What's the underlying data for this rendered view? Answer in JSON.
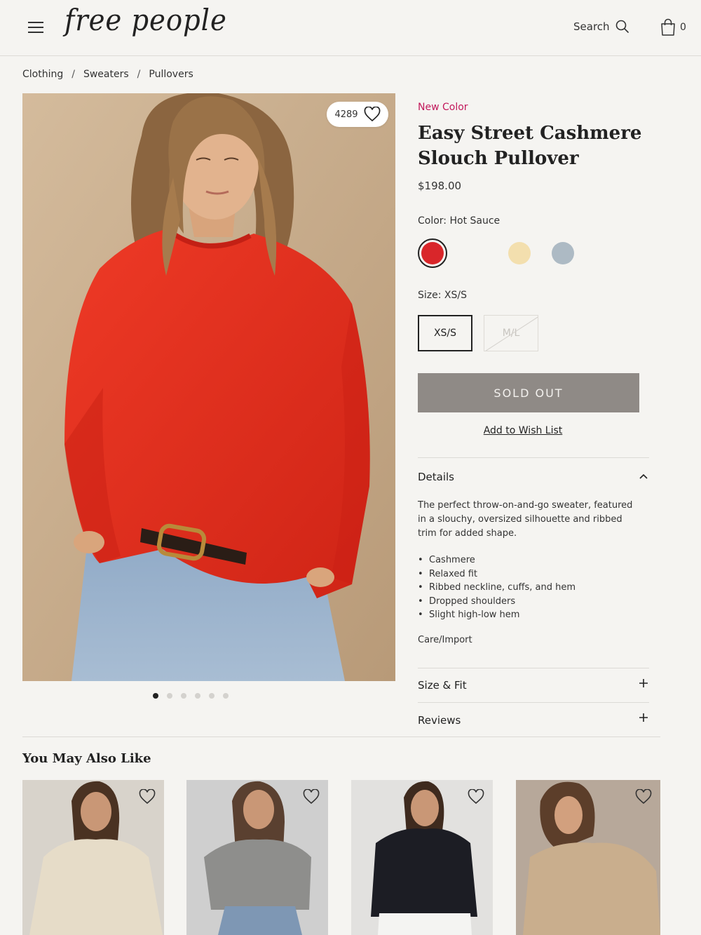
{
  "header": {
    "logo": "free people",
    "search_label": "Search",
    "bag_count": "0"
  },
  "breadcrumb": [
    "Clothing",
    "Sweaters",
    "Pullovers"
  ],
  "gallery": {
    "like_count": "4289",
    "dots_total": 6,
    "active_dot": 1
  },
  "product": {
    "badge": "New Color",
    "title": "Easy Street Cashmere Slouch Pullover",
    "price": "$198.00",
    "color_label": "Color: Hot Sauce",
    "colors": [
      "#d9262a",
      "#8a7f76",
      "#f3dfae",
      "#adbac4"
    ],
    "selected_color": "Hot Sauce",
    "size_label": "Size: XS/S",
    "sizes": [
      {
        "label": "XS/S",
        "state": "selected"
      },
      {
        "label": "M/L",
        "state": "unavailable"
      }
    ],
    "cta": "SOLD OUT",
    "wishlist": "Add to Wish List"
  },
  "details": {
    "title": "Details",
    "description": "The perfect throw-on-and-go sweater, featured in a slouchy, oversized silhouette and ribbed trim for added shape.",
    "bullets": [
      "Cashmere",
      "Relaxed fit",
      "Ribbed neckline, cuffs, and hem",
      "Dropped shoulders",
      "Slight high-low hem"
    ],
    "care": "Care/Import"
  },
  "accordions": {
    "size_fit": "Size & Fit",
    "reviews": "Reviews"
  },
  "recommendations": {
    "title": "You May Also Like",
    "items": [
      {
        "sweater_color": "#e6dcc8"
      },
      {
        "sweater_color": "#8e8e8c"
      },
      {
        "sweater_color": "#1c1d24"
      },
      {
        "sweater_color": "#c9ae8d"
      }
    ]
  },
  "colors": {
    "accent": "#c2185b",
    "sold_out": "#8f8a86",
    "page_bg": "#f5f4f1"
  }
}
